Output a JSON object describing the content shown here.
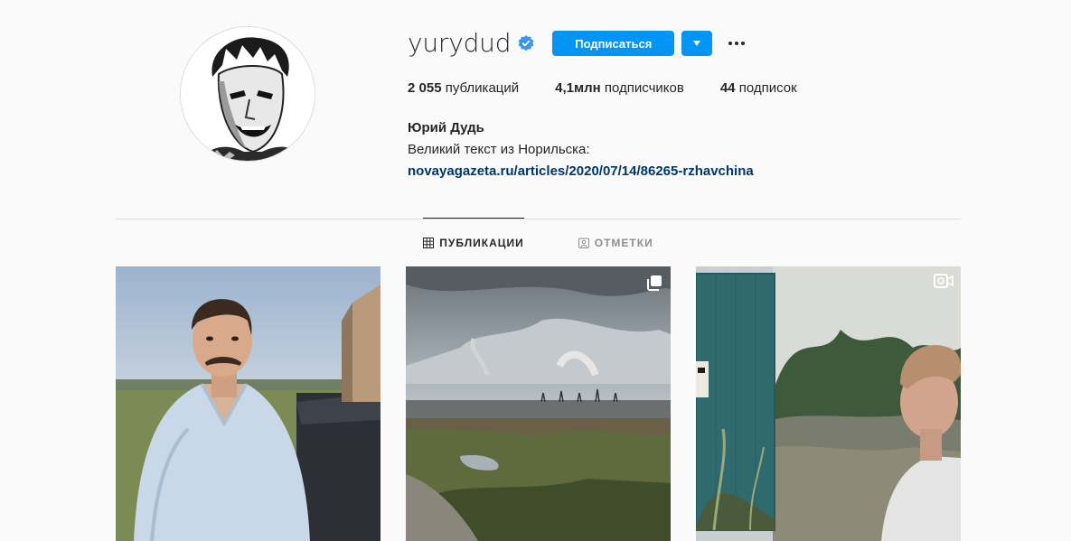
{
  "profile": {
    "username": "yurydud",
    "verified": true,
    "follow_label": "Подписаться",
    "stats": {
      "posts_count": "2 055",
      "posts_label": "публикаций",
      "followers_count": "4,1млн",
      "followers_label": "подписчиков",
      "following_count": "44",
      "following_label": "подписок"
    },
    "full_name": "Юрий Дудь",
    "bio_text": "Великий текст из Норильска:",
    "bio_link": "novayagazeta.ru/articles/2020/07/14/86265-rzhavchina"
  },
  "tabs": [
    {
      "label": "ПУБЛИКАЦИИ",
      "icon": "grid-icon",
      "active": true
    },
    {
      "label": "ОТМЕТКИ",
      "icon": "tagged-icon",
      "active": false
    }
  ],
  "posts": [
    {
      "kind": "photo",
      "badge": "none"
    },
    {
      "kind": "carousel",
      "badge": "multiple-photos-icon"
    },
    {
      "kind": "video",
      "badge": "video-icon"
    }
  ],
  "colors": {
    "accent": "#0095f6",
    "link": "#00376b",
    "background": "#fafafa",
    "border": "#dbdbdb",
    "muted": "#8e8e8e"
  }
}
